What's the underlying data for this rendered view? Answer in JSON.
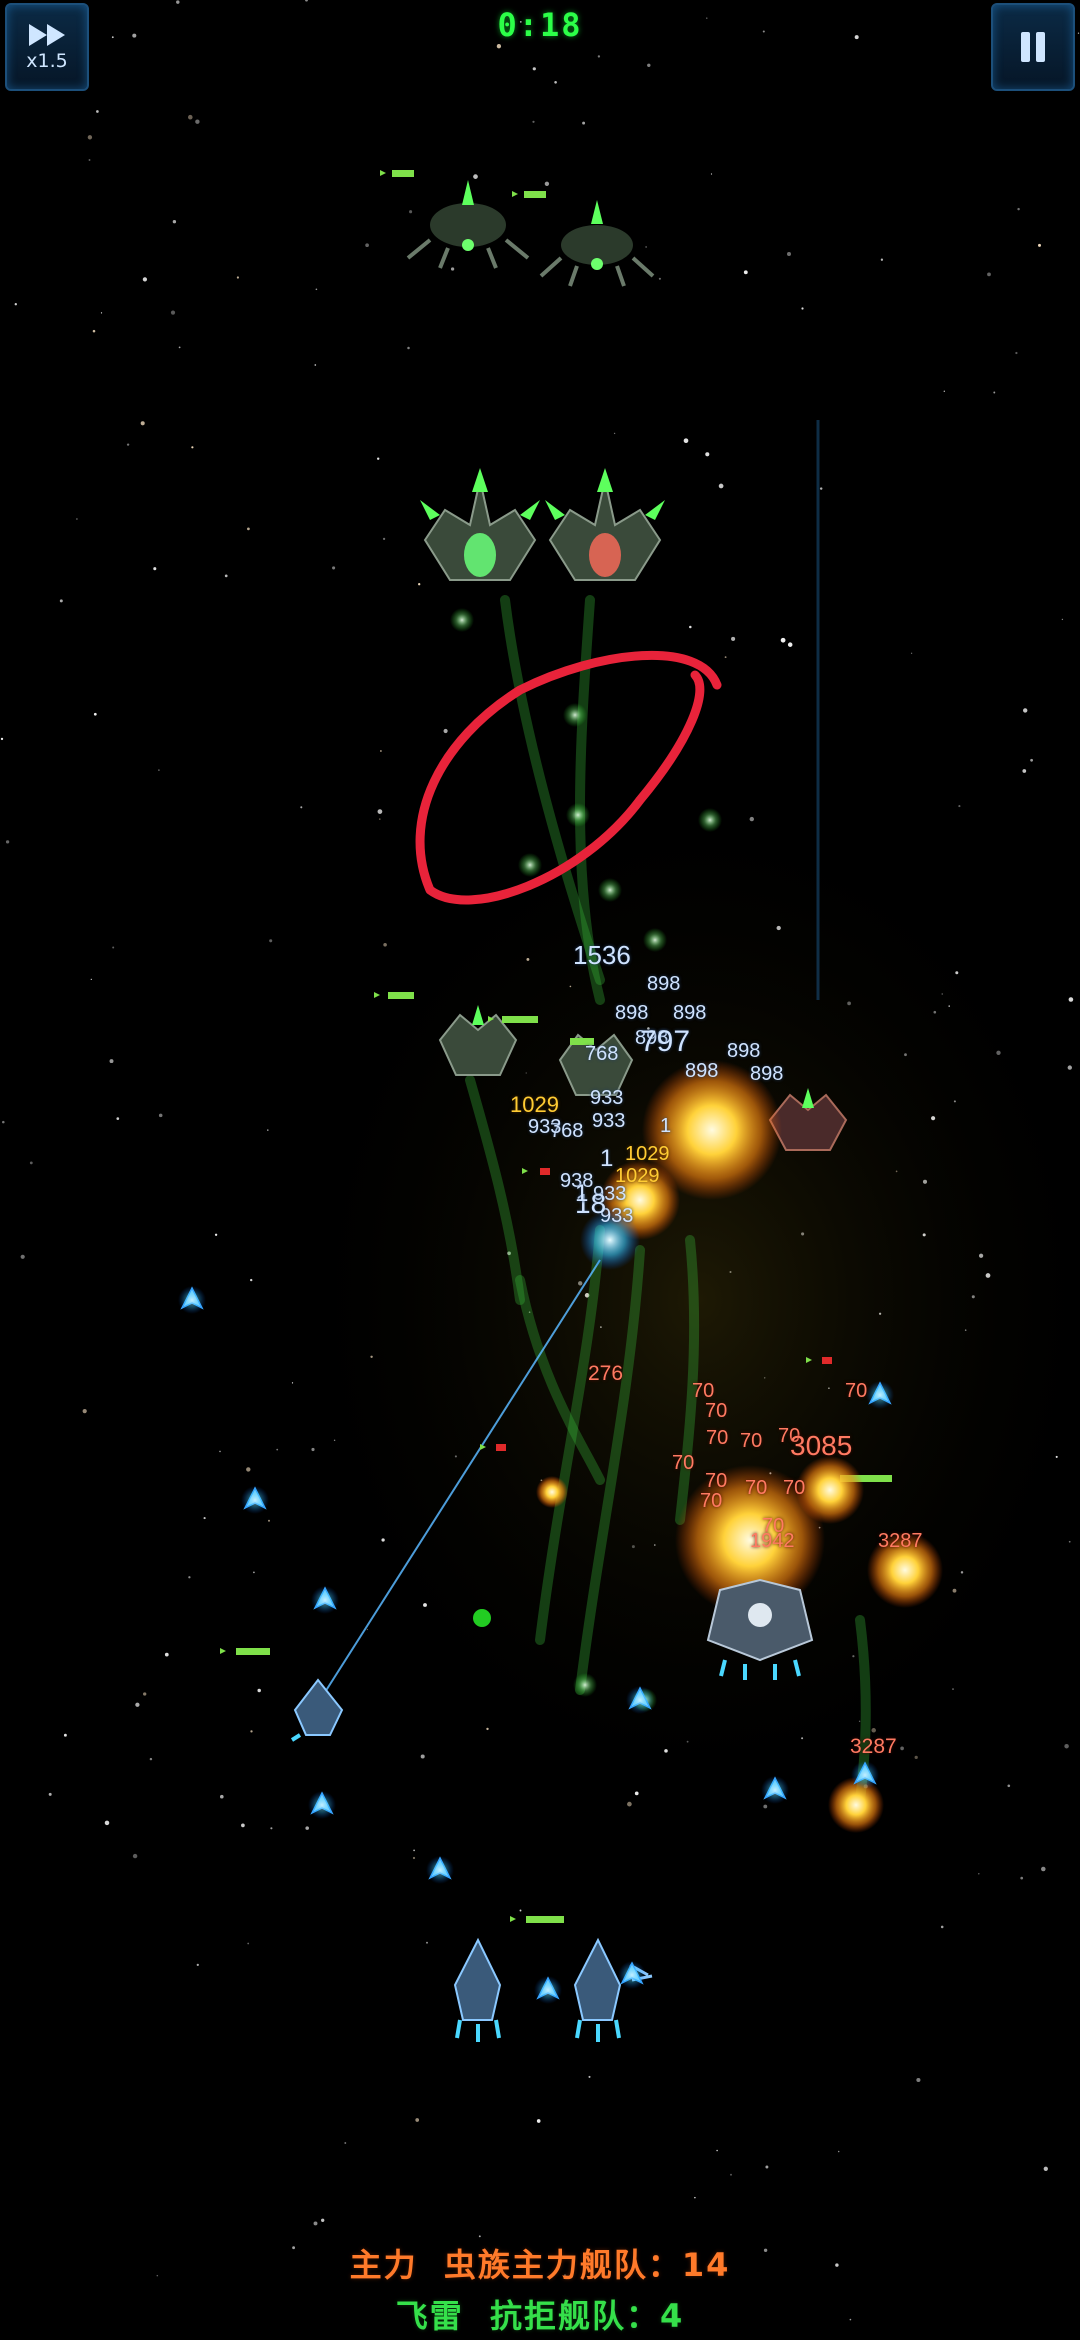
{
  "hud": {
    "timer": "0:18",
    "speed_label": "x1.5",
    "speed_icon": "fast-forward-icon",
    "pause_icon": "pause-icon"
  },
  "damage_numbers": {
    "white": [
      "1536",
      "898",
      "898",
      "898",
      "898",
      "898",
      "797",
      "898",
      "898",
      "768",
      "933",
      "768",
      "933",
      "933",
      "938",
      "933",
      "933",
      "18",
      "1",
      "1",
      "1"
    ],
    "yellow": [
      "1029",
      "1029",
      "1029"
    ],
    "red": [
      "276",
      "70",
      "70",
      "70",
      "70",
      "70",
      "70",
      "70",
      "70",
      "70",
      "70",
      "70",
      "70",
      "3085",
      "1942",
      "3287",
      "3287"
    ]
  },
  "fleets": {
    "main_label": "主力",
    "main_name": "虫族主力舰队：14",
    "support_label": "飞雷",
    "support_name": "抗拒舰队：4"
  },
  "colors": {
    "hud_green": "#2cff48",
    "main_fleet": "#ff7a2a",
    "support_fleet": "#35e04a",
    "annotation": "#e8233a",
    "enemy": "#4cff4c",
    "ally": "#5ad0ff"
  }
}
